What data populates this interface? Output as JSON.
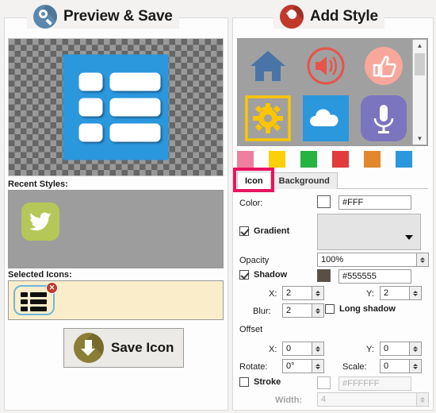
{
  "left_panel": {
    "header": {
      "title": "Preview & Save",
      "icon": "search-icon"
    },
    "preview": {
      "icon_name": "list-icon",
      "background": "transparent-checkerboard",
      "icon_color": "#2b97dd"
    },
    "recent_styles": {
      "label": "Recent Styles:",
      "items": [
        {
          "icon": "twitter-bird-icon",
          "background_color": "#b5c758"
        }
      ]
    },
    "selected_icons": {
      "label": "Selected Icons:",
      "items": [
        {
          "icon": "list-icon",
          "remove_label": "✕"
        }
      ]
    },
    "save_button": {
      "label": "Save Icon",
      "icon": "download-arrow-icon",
      "color": "#8a7d35"
    }
  },
  "right_panel": {
    "header": {
      "title": "Add Style",
      "icon": "droplet-icon"
    },
    "gallery": [
      {
        "icon": "home-icon",
        "color": "#4a74a8"
      },
      {
        "icon": "speaker-icon",
        "color": "#e8534a"
      },
      {
        "icon": "thumbs-up-icon",
        "color": "#f9a79b"
      },
      {
        "icon": "gear-icon",
        "color": "#fcc500"
      },
      {
        "icon": "cloud-icon",
        "color": "#2b97dd"
      },
      {
        "icon": "microphone-icon",
        "color": "#7b74bf"
      }
    ],
    "swatches": [
      "#ef7f9f",
      "#fbd008",
      "#26b33f",
      "#e23b3b",
      "#e2872c",
      "#2b97dd"
    ],
    "tabs": [
      {
        "label": "Icon",
        "active": true
      },
      {
        "label": "Background",
        "active": false
      }
    ],
    "annotation_color": "#e8135f",
    "form": {
      "color_label": "Color:",
      "color_value": "#FFF",
      "color_swatch": "#ffffff",
      "gradient_label": "Gradient",
      "gradient_checked": true,
      "gradient_value": "",
      "opacity_label": "Opacity",
      "opacity_value": "100%",
      "shadow_label": "Shadow",
      "shadow_checked": true,
      "shadow_color_value": "#555555",
      "shadow_swatch": "#5a4f44",
      "shadow_x_label": "X:",
      "shadow_x_value": "2",
      "shadow_y_label": "Y:",
      "shadow_y_value": "2",
      "blur_label": "Blur:",
      "blur_value": "2",
      "long_shadow_label": "Long shadow",
      "long_shadow_checked": false,
      "offset_label": "Offset",
      "offset_x_label": "X:",
      "offset_x_value": "0",
      "offset_y_label": "Y:",
      "offset_y_value": "0",
      "rotate_label": "Rotate:",
      "rotate_value": "0°",
      "scale_label": "Scale:",
      "scale_value": "0",
      "stroke_label": "Stroke",
      "stroke_checked": false,
      "stroke_color_value": "#FFFFFF",
      "width_label": "Width:",
      "width_value": "4"
    }
  }
}
